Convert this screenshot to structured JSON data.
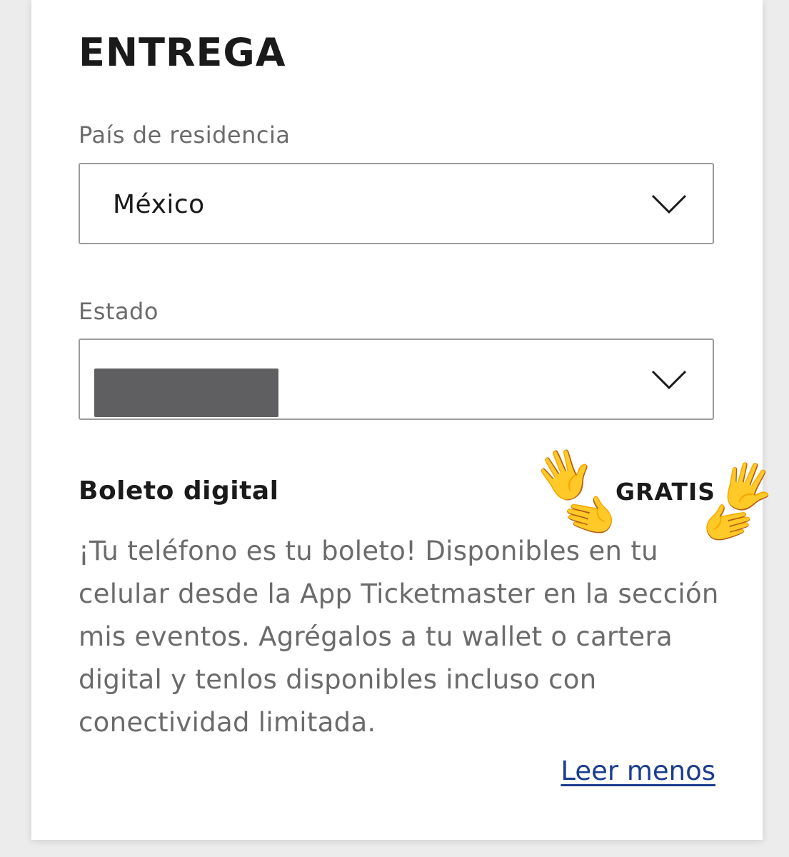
{
  "section": {
    "title": "ENTREGA"
  },
  "country_field": {
    "label": "País de residencia",
    "value": "México",
    "icon": "chevron-down-icon"
  },
  "state_field": {
    "label": "Estado",
    "value": "",
    "icon": "chevron-down-icon"
  },
  "delivery_option": {
    "title": "Boleto digital",
    "price": "GRATIS",
    "description": "¡Tu teléfono es tu boleto! Disponibles en tu celular desde la App Ticketmaster en la sección mis eventos. Agrégalos a tu wallet o cartera digital y tenlos disponibles incluso con conectividad limitada.",
    "read_less_label": "Leer menos"
  },
  "stickers": {
    "hands": [
      "🖐️",
      "🫲",
      "🖐️",
      "🫲"
    ]
  },
  "colors": {
    "background": "#ececec",
    "card": "#ffffff",
    "text_primary": "#1a1a1a",
    "text_secondary": "#6b6b6b",
    "border": "#9b9b9b",
    "link": "#1a3d8f",
    "redaction": "#5f5f61"
  }
}
